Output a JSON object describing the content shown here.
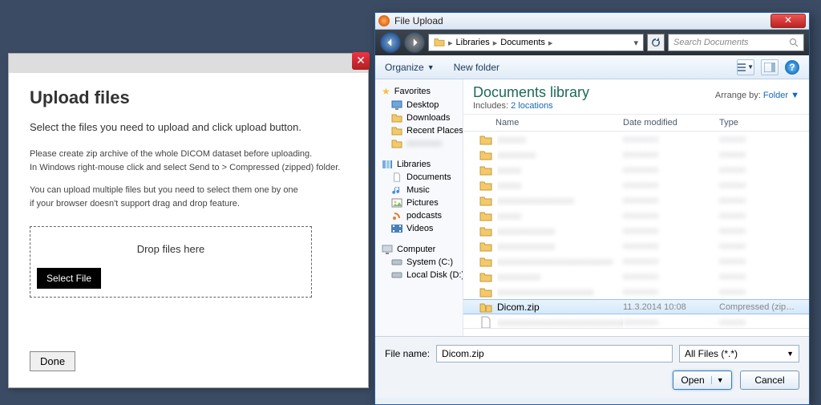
{
  "upload": {
    "title": "Upload files",
    "subtitle": "Select the files you need to upload and click upload button.",
    "note1a": "Please create zip archive of the whole DICOM dataset before uploading.",
    "note1b": "In Windows right-mouse click and select Send to > Compressed (zipped) folder.",
    "note2a": "You can upload multiple files but you need to select them one by one",
    "note2b": "if your browser doesn't support drag and drop feature.",
    "drop_label": "Drop files here",
    "select_file": "Select File",
    "done": "Done"
  },
  "dialog": {
    "window_title": "File Upload",
    "nav": {
      "segments": [
        "Libraries",
        "Documents"
      ],
      "search_placeholder": "Search Documents"
    },
    "toolbar": {
      "organize": "Organize",
      "new_folder": "New folder"
    },
    "sidebar": {
      "favorites": "Favorites",
      "fav_items": [
        "Desktop",
        "Downloads",
        "Recent Places"
      ],
      "libraries": "Libraries",
      "lib_items": [
        "Documents",
        "Music",
        "Pictures",
        "podcasts",
        "Videos"
      ],
      "computer": "Computer",
      "comp_items": [
        "System (C:)",
        "Local Disk (D:)"
      ]
    },
    "library": {
      "title": "Documents library",
      "includes_label": "Includes:",
      "includes_link": "2 locations",
      "arrange_label": "Arrange by:",
      "arrange_value": "Folder"
    },
    "columns": {
      "name": "Name",
      "date": "Date modified",
      "type": "Type"
    },
    "selected_file": {
      "name": "Dicom.zip",
      "date": "11.3.2014 10:08",
      "type": "Compressed (zip…"
    },
    "footer": {
      "filename_label": "File name:",
      "filename_value": "Dicom.zip",
      "filter": "All Files (*.*)",
      "open": "Open",
      "cancel": "Cancel"
    }
  }
}
